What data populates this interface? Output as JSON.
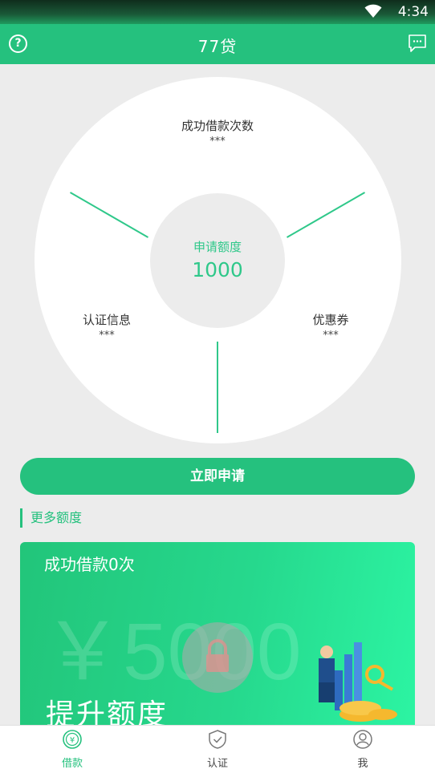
{
  "status": {
    "time": "4:34"
  },
  "header": {
    "title": "77贷"
  },
  "wheel": {
    "center_label": "申请额度",
    "center_value": "1000",
    "top_label": "成功借款次数",
    "top_value": "***",
    "left_label": "认证信息",
    "left_value": "***",
    "right_label": "优惠券",
    "right_value": "***"
  },
  "apply_button": "立即申请",
  "more_section": "更多额度",
  "card": {
    "count_text": "成功借款0次",
    "amount": "￥5000",
    "raise_text": "提升额度"
  },
  "tabs": [
    {
      "label": "借款",
      "icon": "yuan-coin-icon"
    },
    {
      "label": "认证",
      "icon": "shield-check-icon"
    },
    {
      "label": "我",
      "icon": "user-icon"
    }
  ],
  "colors": {
    "accent": "#25c17e"
  }
}
